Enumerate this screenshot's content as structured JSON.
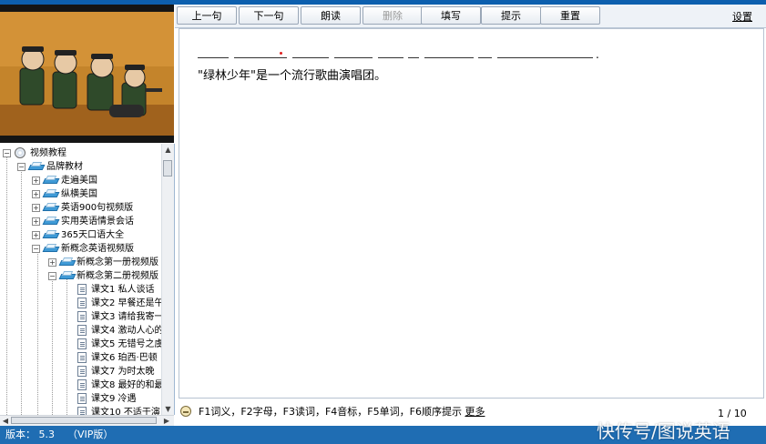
{
  "toolbar": {
    "buttons": [
      {
        "label": "上一句",
        "enabled": true
      },
      {
        "label": "下一句",
        "enabled": true
      },
      {
        "label": "朗读",
        "enabled": true
      },
      {
        "label": "删除",
        "enabled": false
      },
      {
        "label": "填写",
        "enabled": true
      },
      {
        "label": "提示",
        "enabled": true
      },
      {
        "label": "重置",
        "enabled": true
      }
    ],
    "settings_label": "设置"
  },
  "exercise": {
    "period": ".",
    "translation": "\"绿林少年\"是一个流行歌曲演唱团。"
  },
  "tree": {
    "root": "视频教程",
    "items": [
      {
        "label": "品牌教材"
      },
      {
        "label": "走遍美国"
      },
      {
        "label": "纵横美国"
      },
      {
        "label": "英语900句视频版"
      },
      {
        "label": "实用英语情景会话"
      },
      {
        "label": "365天口语大全"
      },
      {
        "label": "新概念英语视频版"
      },
      {
        "label": "新概念第一册视频版"
      },
      {
        "label": "新概念第二册视频版"
      },
      {
        "label": "课文1 私人谈话"
      },
      {
        "label": "课文2 早餐还是午"
      },
      {
        "label": "课文3 请给我寄一"
      },
      {
        "label": "课文4 激动人心的"
      },
      {
        "label": "课文5 无错号之虞"
      },
      {
        "label": "课文6 珀西·巴顿"
      },
      {
        "label": "课文7 为时太晚"
      },
      {
        "label": "课文8 最好的和最"
      },
      {
        "label": "课文9 冷遇"
      },
      {
        "label": "课文10 不适于演"
      }
    ]
  },
  "hint": {
    "text": "F1词义，F2字母，F3读词，F4音标，F5单词，F6顺序提示",
    "more_label": "更多"
  },
  "pager": {
    "current": 1,
    "total": 10,
    "text": "1 / 10"
  },
  "status": {
    "version": "版本： 5.3",
    "edition": "（VIP版）"
  },
  "watermark": "快传号/图说英语"
}
